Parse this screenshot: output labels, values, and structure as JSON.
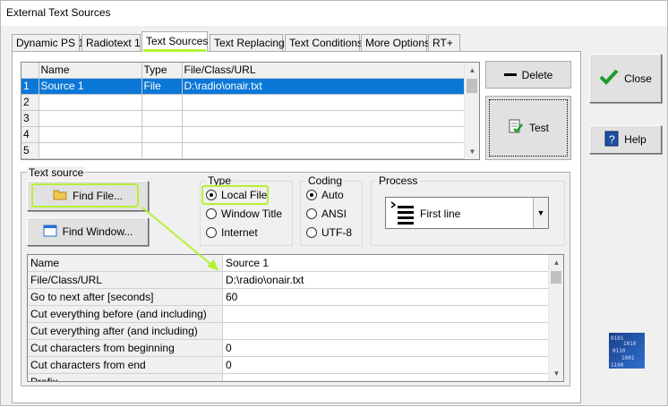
{
  "window": {
    "title": "External Text Sources"
  },
  "tabs": [
    {
      "label": "Dynamic PS 1"
    },
    {
      "label": "Radiotext 1"
    },
    {
      "label": "Text Sources"
    },
    {
      "label": "Text Replacing"
    },
    {
      "label": "Text Conditions"
    },
    {
      "label": "More Options"
    },
    {
      "label": "RT+"
    }
  ],
  "sources_grid": {
    "columns": [
      "Name",
      "Type",
      "File/Class/URL"
    ],
    "rows": [
      {
        "num": "1",
        "name": "Source 1",
        "type": "File",
        "path": "D:\\radio\\onair.txt",
        "selected": true
      },
      {
        "num": "2",
        "name": "",
        "type": "",
        "path": ""
      },
      {
        "num": "3",
        "name": "",
        "type": "",
        "path": ""
      },
      {
        "num": "4",
        "name": "",
        "type": "",
        "path": ""
      },
      {
        "num": "5",
        "name": "",
        "type": "",
        "path": ""
      }
    ]
  },
  "buttons": {
    "delete": "Delete",
    "test": "Test",
    "close": "Close",
    "help": "Help",
    "find_file": "Find File...",
    "find_window": "Find Window..."
  },
  "text_source": {
    "legend": "Text source",
    "type": {
      "legend": "Type",
      "options": [
        "Local File",
        "Window Title",
        "Internet"
      ],
      "selected": "Local File"
    },
    "coding": {
      "legend": "Coding",
      "options": [
        "Auto",
        "ANSI",
        "UTF-8"
      ],
      "selected": "Auto"
    },
    "process": {
      "legend": "Process",
      "selected": "First line"
    }
  },
  "properties": [
    {
      "name": "Name",
      "value": "Source 1"
    },
    {
      "name": "File/Class/URL",
      "value": "D:\\radio\\onair.txt"
    },
    {
      "name": "Go to next after [seconds]",
      "value": "60"
    },
    {
      "name": "Cut everything before (and including)",
      "value": ""
    },
    {
      "name": "Cut everything after (and including)",
      "value": ""
    },
    {
      "name": "Cut characters from beginning",
      "value": "0"
    },
    {
      "name": "Cut characters from end",
      "value": "0"
    },
    {
      "name": "Prefix",
      "value": ""
    }
  ],
  "colors": {
    "selection": "#0b78d7",
    "highlight": "#b6f036",
    "close_check": "#1f9c2b",
    "help_icon": "#1e4fa0"
  }
}
